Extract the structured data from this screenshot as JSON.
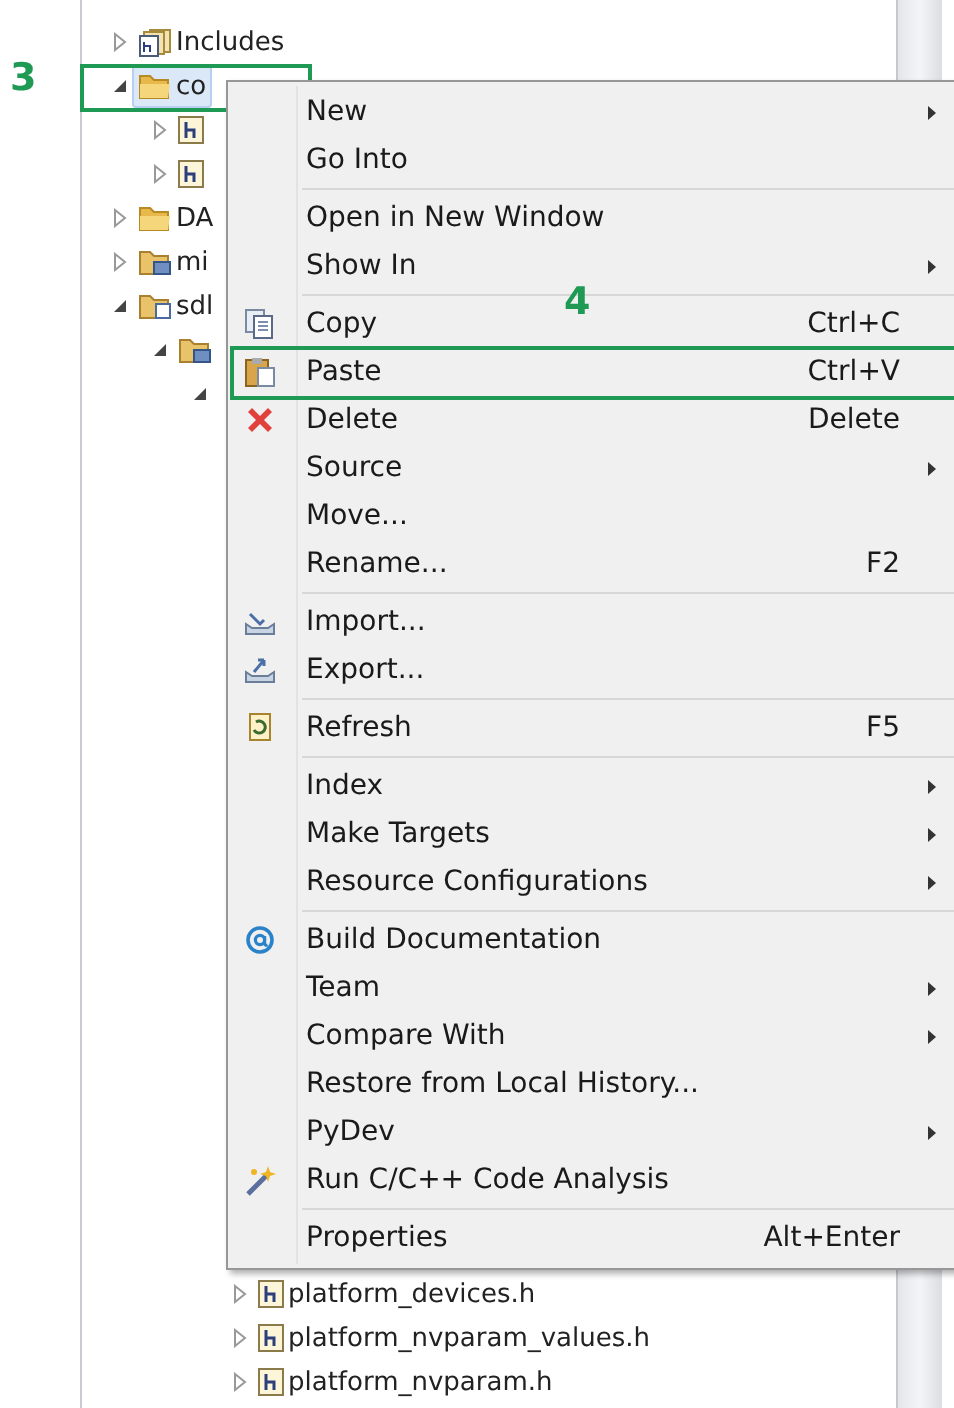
{
  "tree": [
    {
      "label": "Includes",
      "kind": "includes",
      "expanded": false,
      "selected": false
    },
    {
      "label": "co",
      "kind": "folder",
      "expanded": true,
      "selected": true,
      "annotation": "3",
      "children": [
        {
          "kind": "header",
          "expanded": false,
          "selected": false
        },
        {
          "kind": "header",
          "expanded": false,
          "selected": false
        }
      ]
    },
    {
      "label": "DA",
      "kind": "folder",
      "expanded": false,
      "selected": false
    },
    {
      "label": "mi",
      "kind": "source-folder",
      "expanded": false,
      "selected": false
    },
    {
      "label": "sdl",
      "kind": "project",
      "expanded": true,
      "selected": false,
      "children": [
        {
          "kind": "source-folder",
          "expanded": true,
          "selected": false,
          "children": [
            {
              "expanded": true,
              "children": [
                {
                  "label": "platform_devices.h",
                  "kind": "header",
                  "expanded": false,
                  "selected": false
                },
                {
                  "label": "platform_nvparam_values.h",
                  "kind": "header",
                  "expanded": false,
                  "selected": false
                },
                {
                  "label": "platform_nvparam.h",
                  "kind": "header",
                  "expanded": false,
                  "selected": false
                }
              ]
            }
          ]
        }
      ]
    }
  ],
  "context_menu": [
    {
      "kind": "plain",
      "label": "New",
      "submenu": true
    },
    {
      "kind": "plain",
      "label": "Go Into"
    },
    {
      "kind": "separator"
    },
    {
      "kind": "plain",
      "label": "Open in New Window"
    },
    {
      "kind": "plain",
      "label": "Show In",
      "submenu": true
    },
    {
      "kind": "separator"
    },
    {
      "kind": "copy",
      "label": "Copy",
      "shortcut": "Ctrl+C"
    },
    {
      "kind": "paste",
      "label": "Paste",
      "shortcut": "Ctrl+V",
      "annotation": "4"
    },
    {
      "kind": "delete",
      "label": "Delete",
      "shortcut": "Delete"
    },
    {
      "kind": "plain",
      "label": "Source",
      "submenu": true
    },
    {
      "kind": "plain",
      "label": "Move..."
    },
    {
      "kind": "plain",
      "label": "Rename...",
      "shortcut": "F2"
    },
    {
      "kind": "separator"
    },
    {
      "kind": "import",
      "label": "Import..."
    },
    {
      "kind": "export",
      "label": "Export..."
    },
    {
      "kind": "separator"
    },
    {
      "kind": "refresh",
      "label": "Refresh",
      "shortcut": "F5"
    },
    {
      "kind": "separator"
    },
    {
      "kind": "plain",
      "label": "Index",
      "submenu": true
    },
    {
      "kind": "plain",
      "label": "Make Targets",
      "submenu": true
    },
    {
      "kind": "plain",
      "label": "Resource Configurations",
      "submenu": true
    },
    {
      "kind": "separator"
    },
    {
      "kind": "documentation",
      "label": "Build Documentation"
    },
    {
      "kind": "plain",
      "label": "Team",
      "submenu": true
    },
    {
      "kind": "plain",
      "label": "Compare With",
      "submenu": true
    },
    {
      "kind": "plain",
      "label": "Restore from Local History..."
    },
    {
      "kind": "plain",
      "label": "PyDev",
      "submenu": true
    },
    {
      "kind": "analysis",
      "label": "Run C/C++ Code Analysis"
    },
    {
      "kind": "separator"
    },
    {
      "kind": "plain",
      "label": "Properties",
      "shortcut": "Alt+Enter"
    }
  ]
}
